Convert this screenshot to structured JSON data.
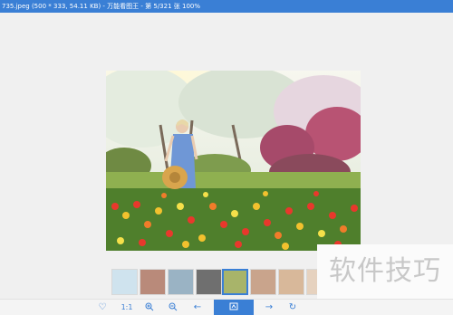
{
  "window": {
    "title": "735.jpeg (500 * 333, 54.11 KB) - 万能看图王 - 第 5/321 张 100%"
  },
  "thumbnails": {
    "selected_index": 4,
    "items": [
      {
        "name": "thumbnail-1",
        "color": "#cfe3ee"
      },
      {
        "name": "thumbnail-2",
        "color": "#b98a7a"
      },
      {
        "name": "thumbnail-3",
        "color": "#9ab3c4"
      },
      {
        "name": "thumbnail-4",
        "color": "#6f6f6f"
      },
      {
        "name": "thumbnail-5",
        "color": "#a8b46a"
      },
      {
        "name": "thumbnail-6",
        "color": "#c9a48c"
      },
      {
        "name": "thumbnail-7",
        "color": "#d8b89a"
      },
      {
        "name": "thumbnail-8",
        "color": "#e6d2bf"
      }
    ]
  },
  "toolbar": {
    "actual_size_label": "1:1",
    "buttons": [
      {
        "name": "favorite-icon"
      },
      {
        "name": "actual-size-button"
      },
      {
        "name": "zoom-in-icon"
      },
      {
        "name": "zoom-out-icon"
      },
      {
        "name": "previous-icon"
      },
      {
        "name": "edit-icon"
      },
      {
        "name": "next-icon"
      },
      {
        "name": "rotate-icon"
      }
    ]
  },
  "watermark": {
    "text": "软件技巧"
  },
  "colors": {
    "accent": "#3a7fd5",
    "background": "#f0f0f0"
  }
}
